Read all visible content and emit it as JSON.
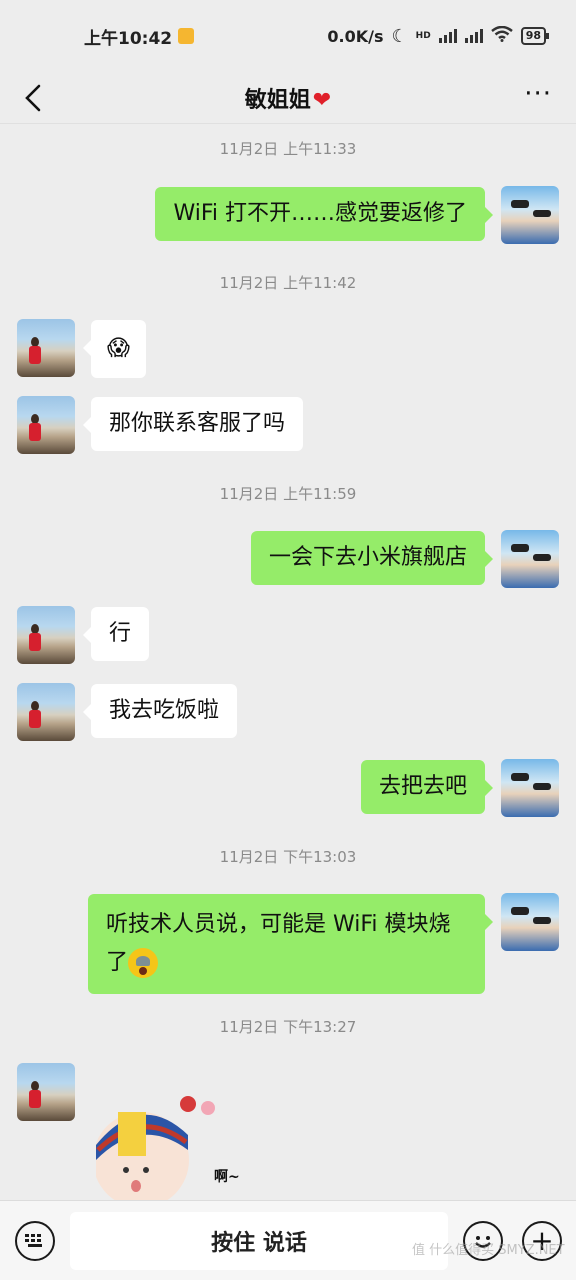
{
  "status_bar": {
    "time": "上午10:42",
    "net_speed": "0.0K/s",
    "hd_label": "HD",
    "battery": "98"
  },
  "header": {
    "title": "敏姐姐",
    "heart": "❤",
    "more": "···"
  },
  "timestamps": [
    "11月2日 上午11:33",
    "11月2日 上午11:42",
    "11月2日 上午11:59",
    "11月2日 下午13:03",
    "11月2日 下午13:27"
  ],
  "messages": [
    {
      "sender": "me",
      "text": "WiFi 打不开……感觉要返修了"
    },
    {
      "sender": "her",
      "text": "😱"
    },
    {
      "sender": "her",
      "text": "那你联系客服了吗"
    },
    {
      "sender": "me",
      "text": "一会下去小米旗舰店"
    },
    {
      "sender": "her",
      "text": "行"
    },
    {
      "sender": "her",
      "text": "我去吃饭啦"
    },
    {
      "sender": "me",
      "text": "去把去吧"
    },
    {
      "sender": "me",
      "text": "听技术人员说，可能是 WiFi 模块烧",
      "text2": "了"
    },
    {
      "sender": "her",
      "sticker_text": "啊~"
    }
  ],
  "input_bar": {
    "keyboard_icon": "keyboard-icon",
    "voice_label": "按住 说话",
    "emoji_icon": "smiley-icon",
    "plus_label": "+"
  },
  "watermark": "值 什么值得买 SMYZ.NET"
}
